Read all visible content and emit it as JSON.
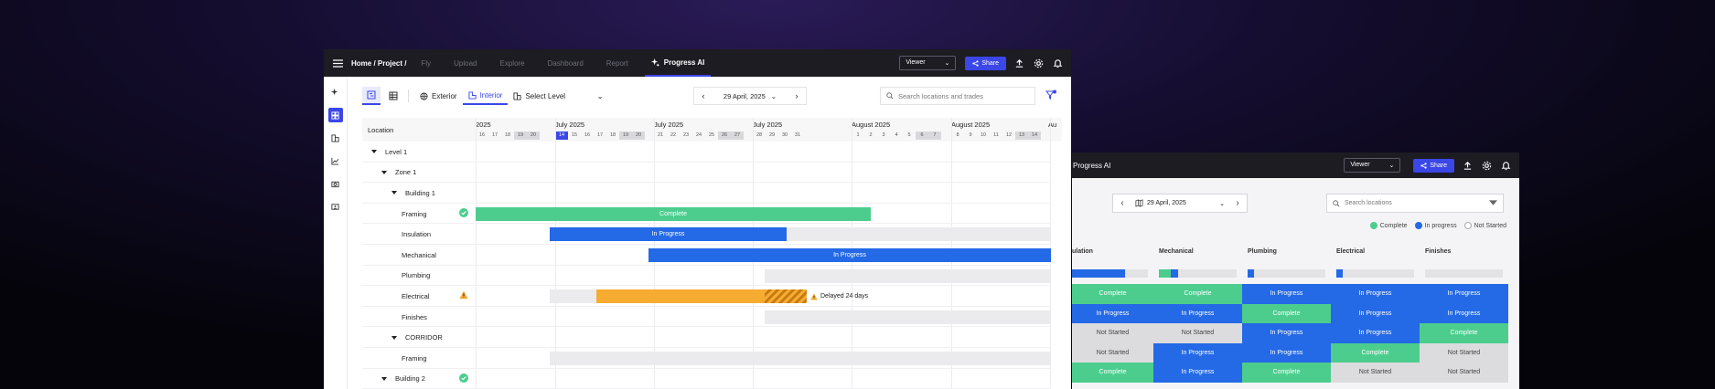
{
  "colors": {
    "accent": "#3b47e6",
    "complete": "#4ccd8e",
    "in_progress": "#2469e6",
    "not_started": "#dcdcdf",
    "delayed": "#f6ac31"
  },
  "front": {
    "breadcrumb": "Home / Project  /",
    "nav": [
      "Fly",
      "Upload",
      "Explore",
      "Dashboard",
      "Report"
    ],
    "active_nav": "Progress AI",
    "viewer": "Viewer",
    "share": "Share",
    "toolbar": {
      "exterior": "Exterior",
      "interior": "Interior",
      "select_level": "Select Level",
      "date": "29 April, 2025",
      "search_placeholder": "Search locations and trades"
    },
    "gantt": {
      "location_header": "Location",
      "months": [
        {
          "label": "2025"
        },
        {
          "label": "July 2025"
        },
        {
          "label": "July 2025"
        },
        {
          "label": "July 2025"
        },
        {
          "label": "August 2025"
        },
        {
          "label": "August 2025"
        },
        {
          "label": "Au"
        }
      ],
      "day_groups": [
        [
          "16",
          "17",
          "18",
          "19",
          "20"
        ],
        [
          "14",
          "15",
          "16",
          "17",
          "18",
          "19",
          "20"
        ],
        [
          "21",
          "22",
          "23",
          "24",
          "25",
          "26",
          "27"
        ],
        [
          "28",
          "29",
          "30",
          "31"
        ],
        [
          "1",
          "2",
          "3",
          "4",
          "5",
          "6",
          "7"
        ],
        [
          "8",
          "9",
          "10",
          "11",
          "12",
          "13",
          "14"
        ]
      ],
      "rows": [
        {
          "label": "Level 1",
          "indent": 0,
          "caret": true
        },
        {
          "label": "Zone 1",
          "indent": 1,
          "caret": true
        },
        {
          "label": "Building 1",
          "indent": 2,
          "caret": true
        },
        {
          "label": "Framing",
          "indent": 3,
          "status": "complete",
          "bar_label": "Complete"
        },
        {
          "label": "Insulation",
          "indent": 3,
          "bar_label": "In Progress"
        },
        {
          "label": "Mechanical",
          "indent": 3,
          "bar_label": "In Progress"
        },
        {
          "label": "Plumbing",
          "indent": 3
        },
        {
          "label": "Electrical",
          "indent": 3,
          "status": "warning",
          "note": "Delayed 24 days"
        },
        {
          "label": "Finishes",
          "indent": 3
        },
        {
          "label": "CORRIDOR",
          "indent": 2,
          "caret": true
        },
        {
          "label": "Framing",
          "indent": 3
        },
        {
          "label": "Building 2",
          "indent": 1,
          "caret": true,
          "status": "complete"
        }
      ]
    }
  },
  "back": {
    "title": "Progress AI",
    "viewer": "Viewer",
    "share": "Share",
    "date": "29 April, 2025",
    "search_placeholder": "Search locations",
    "legend": [
      "Complete",
      "In progress",
      "Not Started"
    ],
    "columns": [
      "ulation",
      "Mechanical",
      "Plumbing",
      "Electrical",
      "Finishes"
    ],
    "progress": [
      {
        "complete": 0,
        "in_progress": 0.7
      },
      {
        "complete": 0.15,
        "in_progress": 0.1
      },
      {
        "complete": 0,
        "in_progress": 0.08
      },
      {
        "complete": 0,
        "in_progress": 0.08
      },
      {
        "complete": 0,
        "in_progress": 0
      }
    ],
    "grid": [
      [
        "Complete",
        "Complete",
        "In Progress",
        "In Progress",
        "In Progress"
      ],
      [
        "In Progress",
        "In Progress",
        "Complete",
        "In Progress",
        "In Progress"
      ],
      [
        "Not Started",
        "Not Started",
        "In Progress",
        "In Progress",
        "Complete"
      ],
      [
        "Not Started",
        "In Progress",
        "In Progress",
        "Complete",
        "Not Started"
      ],
      [
        "Complete",
        "In Progress",
        "Complete",
        "Not Started",
        "Not Started"
      ]
    ]
  }
}
